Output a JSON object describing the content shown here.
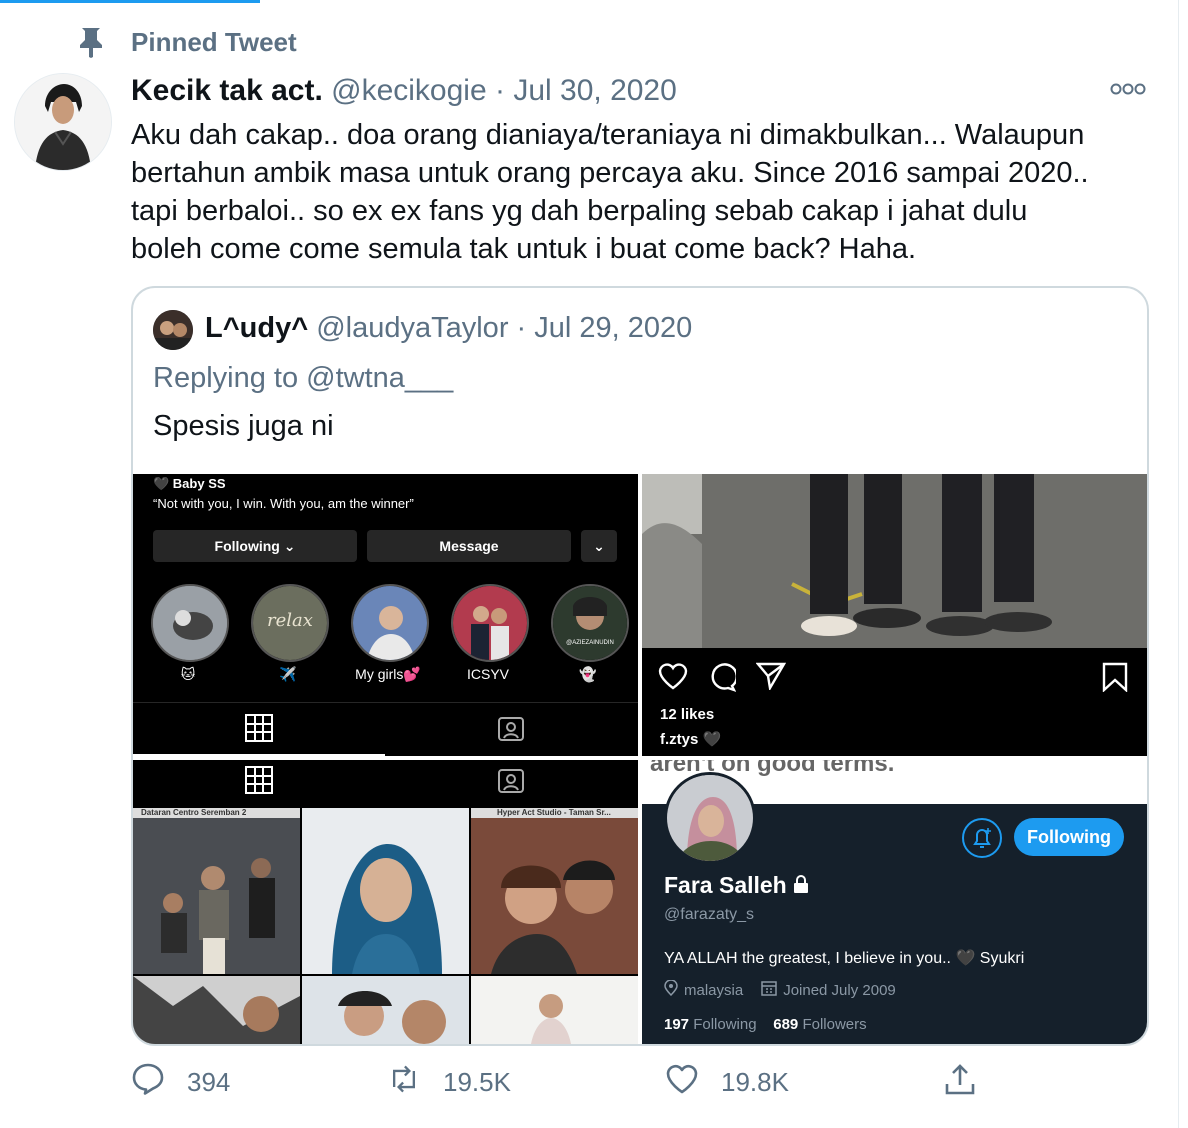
{
  "pinned": {
    "label": "Pinned Tweet",
    "icon": "pin-icon"
  },
  "tweet": {
    "author_name": "Kecik tak act.",
    "author_handle": "@kecikogie",
    "separator": "·",
    "date": "Jul 30, 2020",
    "text": "Aku dah cakap.. doa orang dianiaya/teraniaya ni dimakbulkan... Walaupun\nbertahun ambik masa untuk orang percaya aku. Since 2016 sampai 2020..\ntapi berbaloi.. so ex ex fans yg dah berpaling sebab cakap i jahat dulu\nboleh come come semula tak untuk i buat come back? Haha."
  },
  "quote": {
    "author_name": "L^udy^",
    "author_handle": "@laudyaTaylor",
    "separator": "·",
    "date": "Jul 29, 2020",
    "replying_to": "Replying to @twtna___",
    "text": "Spesis juga ni"
  },
  "instagram_profile": {
    "name": "🖤 Baby SS",
    "bio": "“Not with you, I win. With you, am the winner”",
    "following_button": "Following ⌄",
    "message_button": "Message",
    "dropdown_icon": "⌄",
    "highlights": [
      {
        "label": "🐱"
      },
      {
        "label": "✈️"
      },
      {
        "label": "My girls💕"
      },
      {
        "label": "ICSYV"
      },
      {
        "label": "👻"
      }
    ],
    "highlight_captions": [
      "relax",
      "@AZIEZAINUDIN"
    ]
  },
  "instagram_post": {
    "likes": "12 likes",
    "caption": "f.ztys 🖤"
  },
  "grid_tile": {
    "location_1": "Dataran Centro Seremban 2",
    "location_2": "Hyper Act Studio - Taman Sr..."
  },
  "twitter_profile": {
    "top_text": "aren't on good terms.",
    "following_button": "Following",
    "name": "Fara Salleh",
    "handle": "@farazaty_s",
    "bio": "YA ALLAH the greatest, I believe in you.. 🖤 Syukri",
    "location": "malaysia",
    "joined": "Joined July 2009",
    "following_count": "197",
    "following_label": "Following",
    "followers_count": "689",
    "followers_label": "Followers"
  },
  "actions": {
    "replies": "394",
    "retweets": "19.5K",
    "likes": "19.8K"
  },
  "colors": {
    "accent": "#1d9bf0",
    "muted": "#5b7083",
    "border": "#cfd9de",
    "dark_bg": "#15202b"
  }
}
